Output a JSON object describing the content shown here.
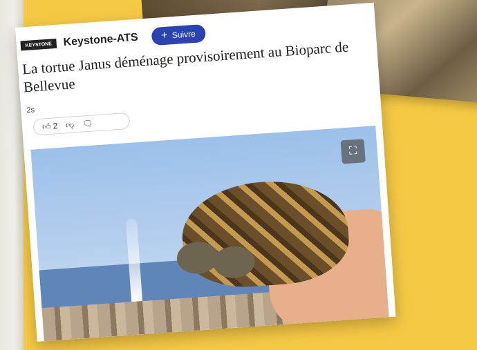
{
  "post": {
    "publisher": "Keystone-ATS",
    "logo_text": "KEYSTONE",
    "follow_label": "Suivre",
    "headline": "La tortue Janus déménage provisoirement au Bioparc de Bellevue",
    "time": "2s",
    "likes": "2"
  },
  "icons": {
    "follow": "plus-icon",
    "like": "thumbs-up-icon",
    "dislike": "thumbs-down-icon",
    "comment": "comment-icon",
    "expand": "fullscreen-icon"
  },
  "colors": {
    "background": "#f6c944",
    "follow_button": "#2b43b0"
  }
}
